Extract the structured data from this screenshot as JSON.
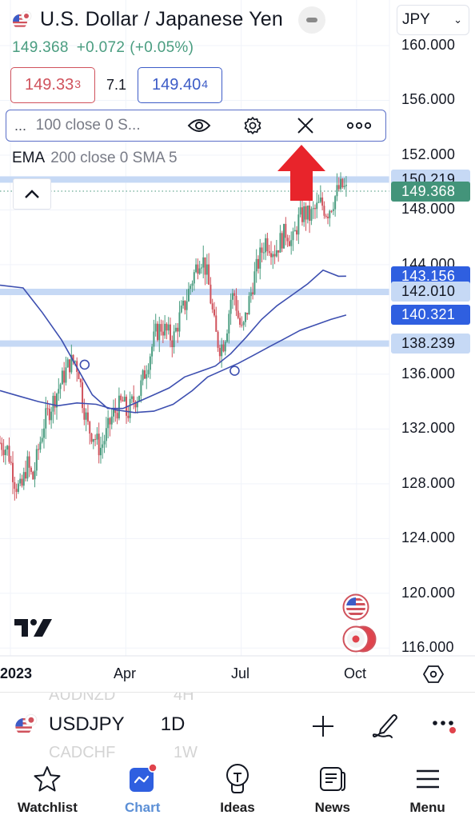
{
  "header": {
    "title": "U.S. Dollar / Japanese Yen",
    "currency_select": {
      "value": "JPY"
    },
    "last_price": "149.368",
    "change": "+0.072",
    "change_pct": "(+0.05%)"
  },
  "quote": {
    "bid_main": "149.33",
    "bid_pip": "3",
    "spread": "7.1",
    "ask_main": "149.40",
    "ask_pip": "4"
  },
  "indicator_bar": {
    "prefix": "...",
    "label": "100 close 0 S...",
    "icons": [
      "eye-icon",
      "gear-icon",
      "close-icon",
      "more-icon"
    ]
  },
  "ema_legend": {
    "name": "EMA",
    "params": "200 close 0 SMA 5"
  },
  "price_axis": {
    "ticks": [
      "160.000",
      "156.000",
      "152.000",
      "148.000",
      "144.000",
      "136.000",
      "132.000",
      "128.000",
      "124.000",
      "120.000",
      "116.000"
    ],
    "tags": [
      {
        "value": "150.219",
        "style": "light"
      },
      {
        "value": "149.368",
        "style": "green"
      },
      {
        "value": "143.156",
        "style": "blue"
      },
      {
        "value": "142.010",
        "style": "light"
      },
      {
        "value": "140.321",
        "style": "blue"
      },
      {
        "value": "138.239",
        "style": "light"
      }
    ]
  },
  "time_axis": {
    "labels": [
      "2023",
      "Apr",
      "Jul",
      "Oct"
    ]
  },
  "colors": {
    "up": "#4a9d80",
    "down": "#d0525c",
    "ma_line": "#3d4fb0",
    "hline": "#c6d9f5",
    "accent": "#2f5fe0",
    "annotation_arrow": "#e8242b"
  },
  "chart_data": {
    "type": "candlestick",
    "symbol": "USDJPY",
    "interval": "1D",
    "ylim": [
      114,
      161
    ],
    "x_range_months": [
      "2023-01",
      "2023-10"
    ],
    "last_price": 149.368,
    "horizontal_levels": [
      150.219,
      142.01,
      138.239
    ],
    "ma_values_at_end": [
      143.156,
      140.321
    ],
    "series_close_path": [
      [
        0.0,
        131.0
      ],
      [
        0.2,
        130.5
      ],
      [
        0.4,
        128.0
      ],
      [
        0.55,
        127.5
      ],
      [
        0.7,
        129.5
      ],
      [
        0.85,
        128.3
      ],
      [
        1.0,
        130.5
      ],
      [
        1.15,
        132.5
      ],
      [
        1.3,
        133.5
      ],
      [
        1.45,
        134.5
      ],
      [
        1.6,
        135.5
      ],
      [
        1.8,
        136.8
      ],
      [
        1.95,
        137.0
      ],
      [
        2.05,
        136.2
      ],
      [
        2.15,
        134.0
      ],
      [
        2.3,
        132.0
      ],
      [
        2.45,
        131.5
      ],
      [
        2.6,
        130.5
      ],
      [
        2.75,
        131.5
      ],
      [
        2.9,
        132.8
      ],
      [
        3.05,
        133.5
      ],
      [
        3.2,
        134.0
      ],
      [
        3.3,
        133.0
      ],
      [
        3.45,
        134.0
      ],
      [
        3.6,
        134.5
      ],
      [
        3.75,
        136.0
      ],
      [
        3.9,
        137.5
      ],
      [
        4.05,
        139.0
      ],
      [
        4.2,
        139.5
      ],
      [
        4.35,
        139.0
      ],
      [
        4.5,
        138.5
      ],
      [
        4.65,
        140.0
      ],
      [
        4.8,
        141.0
      ],
      [
        4.95,
        142.5
      ],
      [
        5.1,
        143.8
      ],
      [
        5.2,
        144.6
      ],
      [
        5.3,
        144.2
      ],
      [
        5.4,
        143.0
      ],
      [
        5.5,
        141.0
      ],
      [
        5.6,
        139.0
      ],
      [
        5.7,
        138.0
      ],
      [
        5.8,
        138.2
      ],
      [
        5.9,
        139.5
      ],
      [
        6.0,
        141.5
      ],
      [
        6.1,
        141.8
      ],
      [
        6.2,
        140.0
      ],
      [
        6.3,
        139.0
      ],
      [
        6.45,
        141.0
      ],
      [
        6.6,
        143.0
      ],
      [
        6.75,
        144.5
      ],
      [
        6.9,
        145.8
      ],
      [
        7.0,
        145.5
      ],
      [
        7.15,
        145.0
      ],
      [
        7.3,
        145.8
      ],
      [
        7.45,
        146.5
      ],
      [
        7.6,
        145.5
      ],
      [
        7.75,
        147.2
      ],
      [
        7.9,
        147.8
      ],
      [
        8.05,
        147.5
      ],
      [
        8.2,
        148.0
      ],
      [
        8.35,
        148.5
      ],
      [
        8.5,
        147.8
      ],
      [
        8.65,
        148.6
      ],
      [
        8.8,
        149.5
      ],
      [
        8.9,
        149.7
      ],
      [
        9.0,
        149.37
      ]
    ],
    "ma_fast_path": [
      [
        0.0,
        142.5
      ],
      [
        0.6,
        142.3
      ],
      [
        1.1,
        140.5
      ],
      [
        1.6,
        138.5
      ],
      [
        2.0,
        136.5
      ],
      [
        2.4,
        134.5
      ],
      [
        2.8,
        133.5
      ],
      [
        3.2,
        133.5
      ],
      [
        3.6,
        134.0
      ],
      [
        4.0,
        134.5
      ],
      [
        4.4,
        135.0
      ],
      [
        4.8,
        135.8
      ],
      [
        5.2,
        136.2
      ],
      [
        5.6,
        136.6
      ],
      [
        6.0,
        137.5
      ],
      [
        6.4,
        138.7
      ],
      [
        6.8,
        140.0
      ],
      [
        7.2,
        141.0
      ],
      [
        7.6,
        141.8
      ],
      [
        8.0,
        142.6
      ],
      [
        8.4,
        143.6
      ],
      [
        8.8,
        143.156
      ],
      [
        9.0,
        143.16
      ]
    ],
    "ma_slow_path": [
      [
        0.0,
        134.8
      ],
      [
        0.5,
        134.4
      ],
      [
        1.0,
        134.0
      ],
      [
        1.5,
        133.7
      ],
      [
        2.0,
        133.9
      ],
      [
        2.5,
        133.8
      ],
      [
        3.0,
        133.4
      ],
      [
        3.5,
        133.2
      ],
      [
        4.0,
        133.3
      ],
      [
        4.5,
        133.8
      ],
      [
        5.0,
        134.8
      ],
      [
        5.4,
        135.8
      ],
      [
        5.8,
        136.3
      ],
      [
        6.2,
        136.8
      ],
      [
        6.6,
        137.4
      ],
      [
        7.0,
        138.0
      ],
      [
        7.4,
        138.6
      ],
      [
        7.8,
        139.2
      ],
      [
        8.2,
        139.6
      ],
      [
        8.6,
        140.0
      ],
      [
        9.0,
        140.321
      ]
    ],
    "crossover_markers": [
      [
        2.2,
        136.7
      ],
      [
        6.1,
        136.25
      ]
    ]
  },
  "symbol_bar": {
    "prev_symbol": "AUDNZD",
    "prev_interval": "4H",
    "symbol": "USDJPY",
    "interval": "1D",
    "next_symbol": "CADCHF",
    "next_interval": "1W"
  },
  "tabs": [
    {
      "label": "Watchlist",
      "icon": "star-icon",
      "active": false
    },
    {
      "label": "Chart",
      "icon": "chart-icon",
      "active": true
    },
    {
      "label": "Ideas",
      "icon": "lightbulb-icon",
      "active": false
    },
    {
      "label": "News",
      "icon": "newspaper-icon",
      "active": false
    },
    {
      "label": "Menu",
      "icon": "hamburger-icon",
      "active": false
    }
  ]
}
